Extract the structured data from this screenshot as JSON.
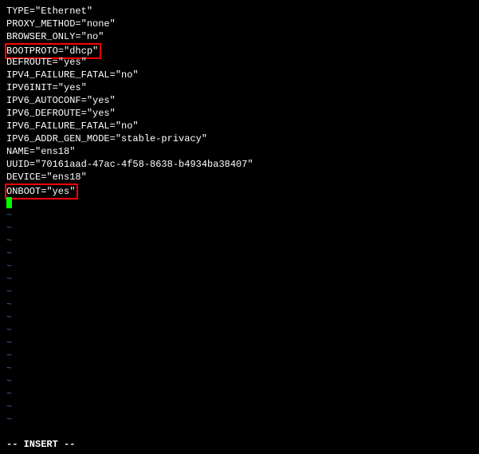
{
  "config": {
    "type": "TYPE=\"Ethernet\"",
    "proxy_method": "PROXY_METHOD=\"none\"",
    "browser_only": "BROWSER_ONLY=\"no\"",
    "bootproto": "BOOTPROTO=\"dhcp\"",
    "defroute": "DEFROUTE=\"yes\"",
    "ipv4_failure_fatal": "IPV4_FAILURE_FATAL=\"no\"",
    "ipv6init": "IPV6INIT=\"yes\"",
    "ipv6_autoconf": "IPV6_AUTOCONF=\"yes\"",
    "ipv6_defroute": "IPV6_DEFROUTE=\"yes\"",
    "ipv6_failure_fatal": "IPV6_FAILURE_FATAL=\"no\"",
    "ipv6_addr_gen_mode": "IPV6_ADDR_GEN_MODE=\"stable-privacy\"",
    "name": "NAME=\"ens18\"",
    "uuid": "UUID=\"70161aad-47ac-4f58-8638-b4934ba38407\"",
    "device": "DEVICE=\"ens18\"",
    "onboot": "ONBOOT=\"yes\""
  },
  "tilde": "~",
  "status": "-- INSERT --"
}
